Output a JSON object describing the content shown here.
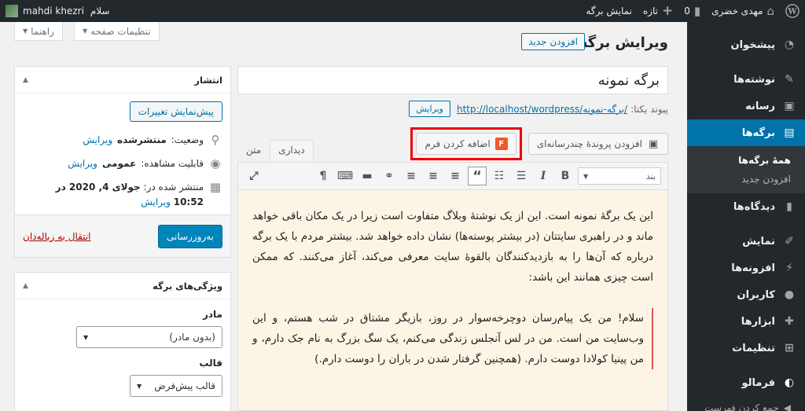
{
  "adminbar": {
    "site_name": "مهدی خضری",
    "comments_count": "0",
    "new_label": "تازه",
    "view_page": "نمایش برگه",
    "greeting": "سلام",
    "user_name": "mahdi khezri"
  },
  "menu": {
    "dashboard": "پیشخوان",
    "posts": "نوشته‌ها",
    "media": "رسانه",
    "pages": "برگه‌ها",
    "pages_sub_all": "همهٔ برگه‌ها",
    "pages_sub_add": "افزودن جدید",
    "comments": "دیدگاه‌ها",
    "appearance": "نمایش",
    "plugins": "افزونه‌ها",
    "users": "کاربران",
    "tools": "ابزارها",
    "settings": "تنظیمات",
    "formalo": "فرمالو",
    "collapse": "جمع کردن فهرست"
  },
  "screen_options": "تنظیمات صفحه",
  "help": "راهنما",
  "page_title": "ویرایش برگه",
  "add_new": "افزودن جدید",
  "post_title": "برگه نمونه",
  "permalink": {
    "label": "پیوند یکتا:",
    "url_base": "http://localhost/wordpress/",
    "slug": "برگه-نمونه/",
    "edit": "ویرایش"
  },
  "media": {
    "add_media": "افزودن پروندهٔ چندرسانه‌ای",
    "add_form": "اضافه کردن فرم"
  },
  "editor_tabs": {
    "visual": "دیداری",
    "text": "متن"
  },
  "format_select": "بند",
  "content": {
    "paragraph": "این یک برگهٔ نمونه است. این از یک نوشتهٔ وبلاگ متفاوت است زیرا در یک مکان باقی خواهد ماند و در راهبری سایتتان (در بیشتر پوسته‌ها) نشان داده خواهد شد. بیشتر مردم با یک برگه درباره که آن‌ها را به بازدیدکنندگان بالقوهٔ سایت معرفی می‌کند، آغاز می‌کنند. که ممکن است چیزی همانند این باشد:",
    "quote": "سلام! من یک پیام‌رسان دوچرخه‌سوار در روز، بازیگر مشتاق در شب هستم، و این وب‌سایت من است. من در لس آنجلس زندگی می‌کنم، یک سگ بزرگ به نام جک دارم، و من پینیا کولادا دوست دارم. (همچنین گرفتار شدن در باران را دوست دارم.)"
  },
  "publish": {
    "title": "انتشار",
    "preview": "پیش‌نمایش تغییرات",
    "status_label": "وضعیت:",
    "status_value": "منتشرشده",
    "edit": "ویرایش",
    "visibility_label": "قابلیت مشاهده:",
    "visibility_value": "عمومی",
    "published_label": "منتشر شده در:",
    "published_value": "جولای 4, 2020 در",
    "published_time": "10:52",
    "trash": "انتقال به زباله‌دان",
    "update": "به‌روزرسانی"
  },
  "attributes": {
    "title": "ویژگی‌های برگه",
    "parent_label": "مادر",
    "parent_value": "(بدون مادر)",
    "template_label": "قالب",
    "template_value": "قالب پیش‌فرض"
  },
  "colors": {
    "admin_dark": "#23282d",
    "accent": "#0073aa",
    "highlight": "#e00000",
    "editor_bg": "#fcf5e6",
    "form_icon": "#f0592a"
  }
}
